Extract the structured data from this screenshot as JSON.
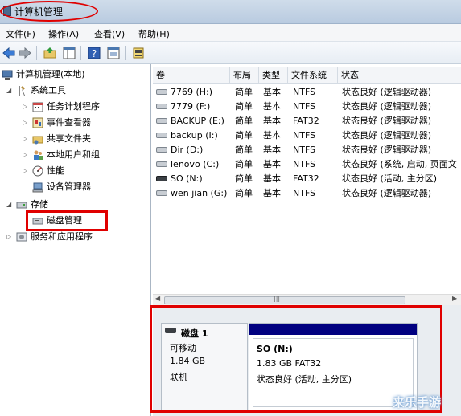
{
  "window": {
    "title": "计算机管理"
  },
  "menu": [
    "文件(F)",
    "操作(A)",
    "查看(V)",
    "帮助(H)"
  ],
  "tree": {
    "root": "计算机管理(本地)",
    "system_tools": "系统工具",
    "items": [
      "任务计划程序",
      "事件查看器",
      "共享文件夹",
      "本地用户和组",
      "性能",
      "设备管理器"
    ],
    "storage": "存储",
    "disk_mgmt": "磁盘管理",
    "services": "服务和应用程序"
  },
  "columns": [
    "卷",
    "布局",
    "类型",
    "文件系统",
    "状态"
  ],
  "rows": [
    {
      "vol": "7769 (H:)",
      "layout": "简单",
      "type": "基本",
      "fs": "NTFS",
      "status": "状态良好 (逻辑驱动器)"
    },
    {
      "vol": "7779 (F:)",
      "layout": "简单",
      "type": "基本",
      "fs": "NTFS",
      "status": "状态良好 (逻辑驱动器)"
    },
    {
      "vol": "BACKUP (E:)",
      "layout": "简单",
      "type": "基本",
      "fs": "FAT32",
      "status": "状态良好 (逻辑驱动器)"
    },
    {
      "vol": "backup (I:)",
      "layout": "简单",
      "type": "基本",
      "fs": "NTFS",
      "status": "状态良好 (逻辑驱动器)"
    },
    {
      "vol": "Dir (D:)",
      "layout": "简单",
      "type": "基本",
      "fs": "NTFS",
      "status": "状态良好 (逻辑驱动器)"
    },
    {
      "vol": "lenovo (C:)",
      "layout": "简单",
      "type": "基本",
      "fs": "NTFS",
      "status": "状态良好 (系统, 启动, 页面文"
    },
    {
      "vol": "SO (N:)",
      "layout": "简单",
      "type": "基本",
      "fs": "FAT32",
      "status": "状态良好 (活动, 主分区)"
    },
    {
      "vol": "wen jian (G:)",
      "layout": "简单",
      "type": "基本",
      "fs": "NTFS",
      "status": "状态良好 (逻辑驱动器)"
    }
  ],
  "disk": {
    "name": "磁盘 1",
    "kind": "可移动",
    "size": "1.84 GB",
    "state": "联机",
    "partition": {
      "label": "SO   (N:)",
      "size_fs": "1.83 GB FAT32",
      "status": "状态良好 (活动, 主分区)"
    }
  },
  "watermark": "来乐手游",
  "colors": {
    "partition_bar": "#000080",
    "annotation": "#e00000"
  }
}
